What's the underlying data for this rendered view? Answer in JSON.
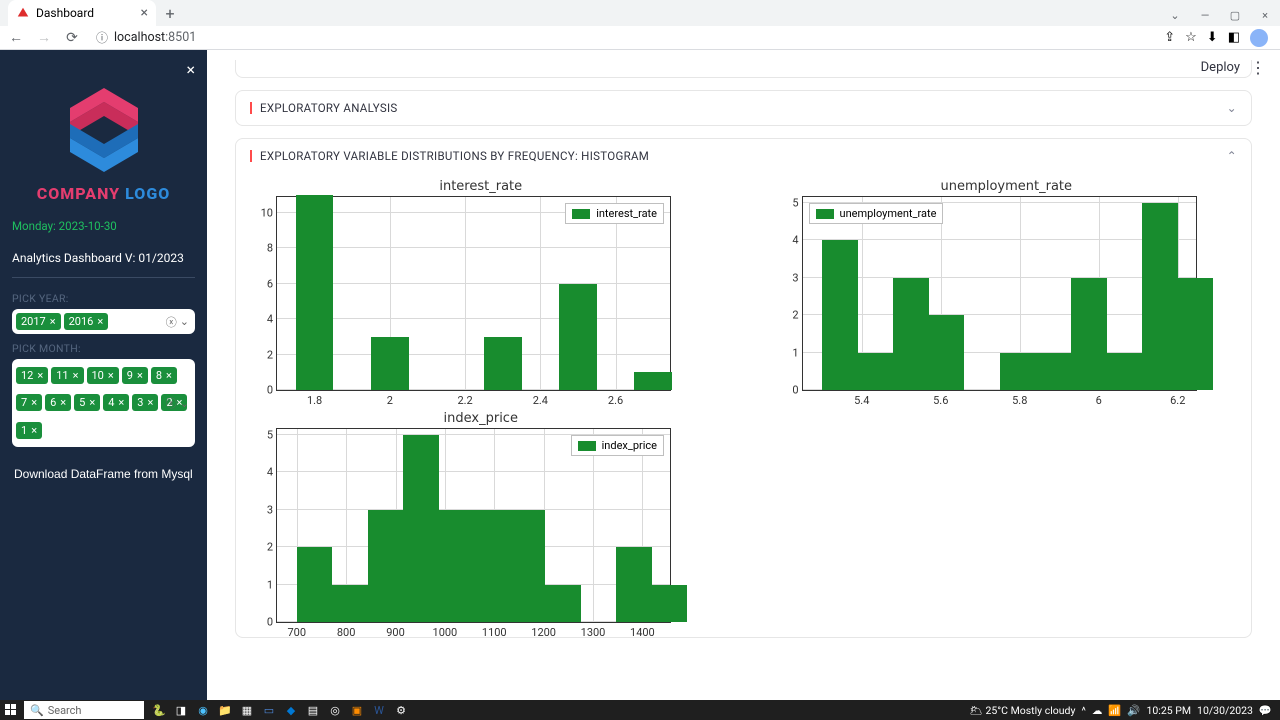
{
  "browser": {
    "tab_title": "Dashboard",
    "url_prefix": "localhost",
    "url_port": ":8501"
  },
  "taskbar": {
    "search_placeholder": "Search",
    "weather": "25°C  Mostly cloudy",
    "time": "10:25 PM",
    "date": "10/30/2023"
  },
  "sidebar": {
    "logo_line1": "COMPANY",
    "logo_line2": "LOGO",
    "date_label": "Monday: 2023-10-30",
    "version": "Analytics Dashboard V: 01/2023",
    "year_label": "PICK YEAR:",
    "year_tags": [
      "2017",
      "2016"
    ],
    "month_label": "PICK MONTH:",
    "month_tags": [
      "12",
      "11",
      "10",
      "9",
      "8",
      "7",
      "6",
      "5",
      "4",
      "3",
      "2",
      "1"
    ],
    "download_label": "Download DataFrame from Mysql"
  },
  "main": {
    "deploy": "Deploy",
    "expander1": "EXPLORATORY ANALYSIS",
    "expander2": "EXPLORATORY VARIABLE DISTRIBUTIONS BY FREQUENCY: HISTOGRAM"
  },
  "chart_data": [
    {
      "type": "bar",
      "title": "interest_rate",
      "legend": "interest_rate",
      "legend_pos": "right",
      "xticks": [
        1.8,
        2.0,
        2.2,
        2.4,
        2.6
      ],
      "yticks": [
        0,
        2,
        4,
        6,
        8,
        10
      ],
      "ylim": [
        0,
        11
      ],
      "bins_left": [
        1.75,
        1.85,
        1.95,
        2.05,
        2.15,
        2.25,
        2.35,
        2.45,
        2.55,
        2.65
      ],
      "bin_width": 0.1,
      "xrange": [
        1.7,
        2.75
      ],
      "values": [
        11,
        0,
        3,
        0,
        0,
        3,
        0,
        6,
        0,
        1
      ]
    },
    {
      "type": "bar",
      "title": "unemployment_rate",
      "legend": "unemployment_rate",
      "legend_pos": "left",
      "xticks": [
        5.4,
        5.6,
        5.8,
        6.0,
        6.2
      ],
      "yticks": [
        0,
        1,
        2,
        3,
        4,
        5
      ],
      "ylim": [
        0,
        5.2
      ],
      "bins_left": [
        5.3,
        5.39,
        5.48,
        5.57,
        5.66,
        5.75,
        5.84,
        5.93,
        6.02,
        6.11
      ],
      "bin_width": 0.09,
      "xrange": [
        5.25,
        6.25
      ],
      "values": [
        4,
        1,
        3,
        2,
        0,
        1,
        1,
        3,
        1,
        5,
        3
      ]
    },
    {
      "type": "bar",
      "title": "index_price",
      "legend": "index_price",
      "legend_pos": "right",
      "xticks": [
        700,
        800,
        900,
        1000,
        1100,
        1200,
        1300,
        1400
      ],
      "yticks": [
        0,
        1,
        2,
        3,
        4,
        5
      ],
      "ylim": [
        0,
        5.2
      ],
      "bins_left": [
        700,
        771.9,
        843.8,
        915.7,
        987.6,
        1059.5,
        1131.4,
        1203.3,
        1275.2,
        1347.1
      ],
      "bin_width": 71.9,
      "xrange": [
        660,
        1460
      ],
      "values": [
        2,
        1,
        3,
        5,
        3,
        3,
        3,
        1,
        0,
        2,
        1
      ]
    }
  ]
}
